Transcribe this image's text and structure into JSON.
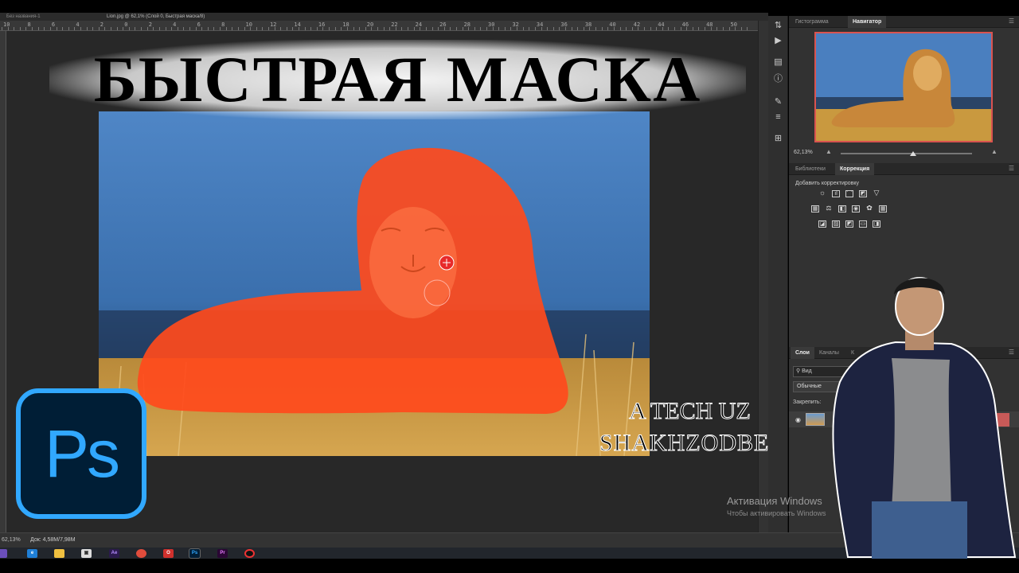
{
  "document": {
    "tabs": [
      "Без названия-1",
      "Lion.jpg @ 62,1% (Слой 0, Быстрая маска/8)"
    ]
  },
  "ruler": {
    "numbers": [
      "10",
      "8",
      "6",
      "4",
      "2",
      "0",
      "2",
      "4",
      "6",
      "8",
      "10",
      "12",
      "14",
      "16",
      "18",
      "20",
      "22",
      "24",
      "26",
      "28",
      "30",
      "32",
      "34",
      "36",
      "38",
      "40",
      "42",
      "44",
      "46",
      "48",
      "50"
    ]
  },
  "overlay": {
    "title": "БЫСТРАЯ МАСКА",
    "credit_line1": "A TECH UZ",
    "credit_line2": "SHAKHZODBEK",
    "logo_text": "Ps"
  },
  "status": {
    "zoom": "62,13%",
    "doc": "Док: 4,58M/7,98M"
  },
  "panels": {
    "top_tabs": [
      "Гистограмма",
      "Навигатор"
    ],
    "navigator_zoom": "62,13%",
    "navigator_level": 0.55,
    "mid_tabs": [
      "Библиотеки",
      "Коррекция"
    ],
    "correction_label": "Добавить корректировку",
    "layer_tabs": [
      "Слои",
      "Каналы",
      "К"
    ],
    "search_value": "Вид",
    "blend_mode": "Обычные",
    "lock_label": "Закрепить:"
  },
  "windows": {
    "activate_title": "Активация Windows",
    "activate_sub": "Чтобы активировать Windows"
  },
  "colors": {
    "mask_overlay": "#ff4a1c",
    "sky": "#3f74b5",
    "ps_blue": "#31a8ff",
    "ps_dark": "#001e36",
    "accent_red": "#d9534f"
  },
  "taskbar_icons": [
    "app-icon",
    "edge-icon",
    "explorer-icon",
    "store-icon",
    "after-effects-icon",
    "chrome-icon",
    "opera-icon",
    "photoshop-icon",
    "premiere-icon",
    "record-icon"
  ]
}
